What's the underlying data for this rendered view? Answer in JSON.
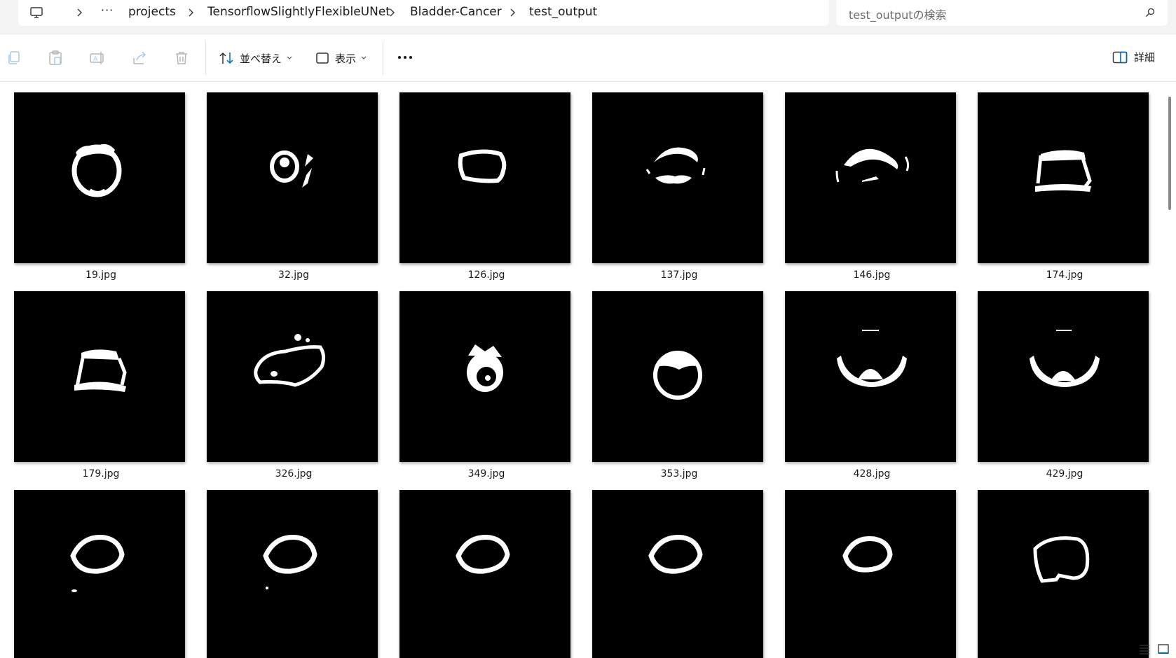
{
  "address_bar": {
    "overflow": "···",
    "crumbs": [
      "projects",
      "TensorflowSlightlyFlexibleUNet",
      "Bladder-Cancer",
      "test_output"
    ]
  },
  "search": {
    "placeholder": "test_outputの検索"
  },
  "toolbar": {
    "icons": [
      "copy-icon",
      "paste-icon",
      "rename-icon",
      "share-icon",
      "delete-icon"
    ],
    "sort_label": "並べ替え",
    "view_label": "表示",
    "more": "···",
    "details_label": "詳細"
  },
  "files": [
    {
      "name": "19.jpg"
    },
    {
      "name": "32.jpg"
    },
    {
      "name": "126.jpg"
    },
    {
      "name": "137.jpg"
    },
    {
      "name": "146.jpg"
    },
    {
      "name": "174.jpg"
    },
    {
      "name": "179.jpg"
    },
    {
      "name": "326.jpg"
    },
    {
      "name": "349.jpg"
    },
    {
      "name": "353.jpg"
    },
    {
      "name": "428.jpg"
    },
    {
      "name": "429.jpg"
    },
    {
      "name": ""
    },
    {
      "name": ""
    },
    {
      "name": ""
    },
    {
      "name": ""
    },
    {
      "name": ""
    },
    {
      "name": ""
    }
  ],
  "colors": {
    "accent": "#0067c0",
    "thumb_bg": "#000000",
    "mask": "#ffffff"
  }
}
